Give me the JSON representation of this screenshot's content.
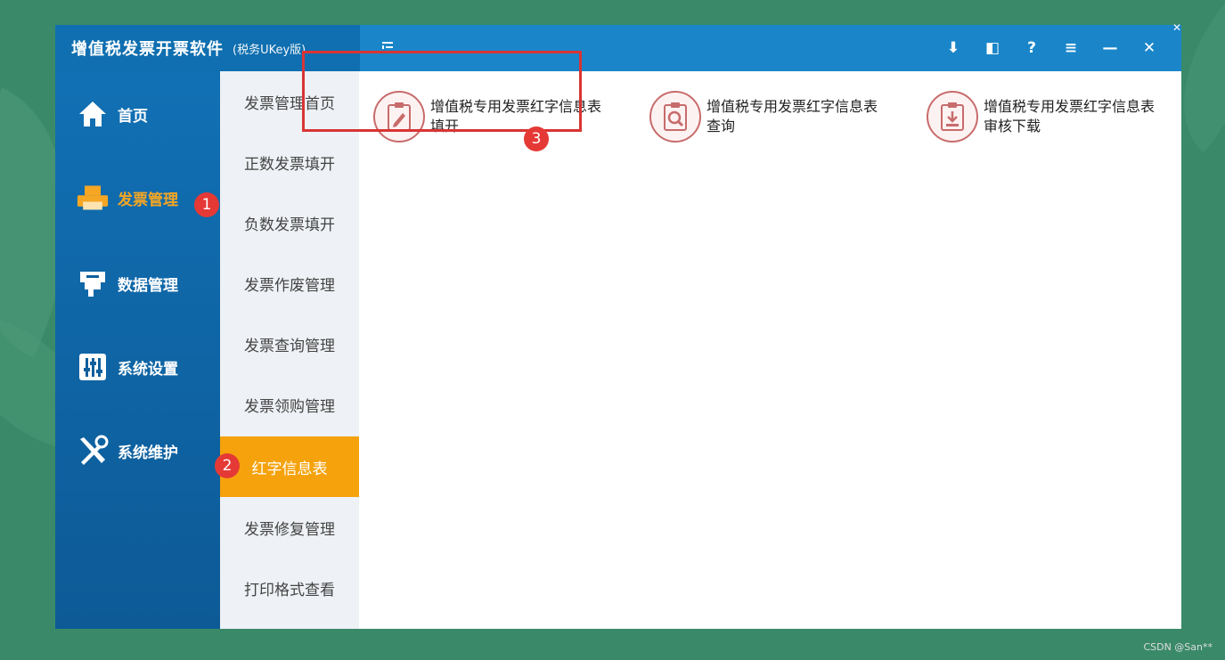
{
  "app": {
    "title": "增值税发票开票软件",
    "subtitle": "(税务UKey版)"
  },
  "titlebar": {
    "menu_icon": "list-indent-icon",
    "buttons": [
      {
        "name": "download-icon",
        "glyph": "⬇"
      },
      {
        "name": "restore-icon",
        "glyph": "◧"
      },
      {
        "name": "help-icon",
        "glyph": "?"
      },
      {
        "name": "menu-icon",
        "glyph": "≡"
      },
      {
        "name": "minimize-icon",
        "glyph": "—"
      },
      {
        "name": "close-icon",
        "glyph": "✕"
      }
    ]
  },
  "main_nav": [
    {
      "label": "首页",
      "icon": "home-icon",
      "active": false
    },
    {
      "label": "发票管理",
      "icon": "printer-icon",
      "active": true
    },
    {
      "label": "数据管理",
      "icon": "database-icon",
      "active": false
    },
    {
      "label": "系统设置",
      "icon": "sliders-icon",
      "active": false
    },
    {
      "label": "系统维护",
      "icon": "tools-icon",
      "active": false
    }
  ],
  "sub_nav": [
    {
      "label": "发票管理首页",
      "active": false
    },
    {
      "label": "正数发票填开",
      "active": false
    },
    {
      "label": "负数发票填开",
      "active": false
    },
    {
      "label": "发票作废管理",
      "active": false
    },
    {
      "label": "发票查询管理",
      "active": false
    },
    {
      "label": "发票领购管理",
      "active": false
    },
    {
      "label": "红字信息表",
      "active": true
    },
    {
      "label": "发票修复管理",
      "active": false
    },
    {
      "label": "打印格式查看",
      "active": false
    }
  ],
  "tiles": [
    {
      "line1": "增值税专用发票红字信息表",
      "line2": "填开",
      "icon": "edit-document-icon"
    },
    {
      "line1": "增值税专用发票红字信息表",
      "line2": "查询",
      "icon": "search-document-icon"
    },
    {
      "line1": "增值税专用发票红字信息表",
      "line2": "审核下载",
      "icon": "download-document-icon"
    }
  ],
  "badges": [
    "1",
    "2",
    "3"
  ],
  "watermark": "CSDN @San**",
  "colors": {
    "titlebar": "#1a86c9",
    "sidebar": "#0f5f9c",
    "accent": "#f5a20c",
    "highlight": "#d93434"
  }
}
